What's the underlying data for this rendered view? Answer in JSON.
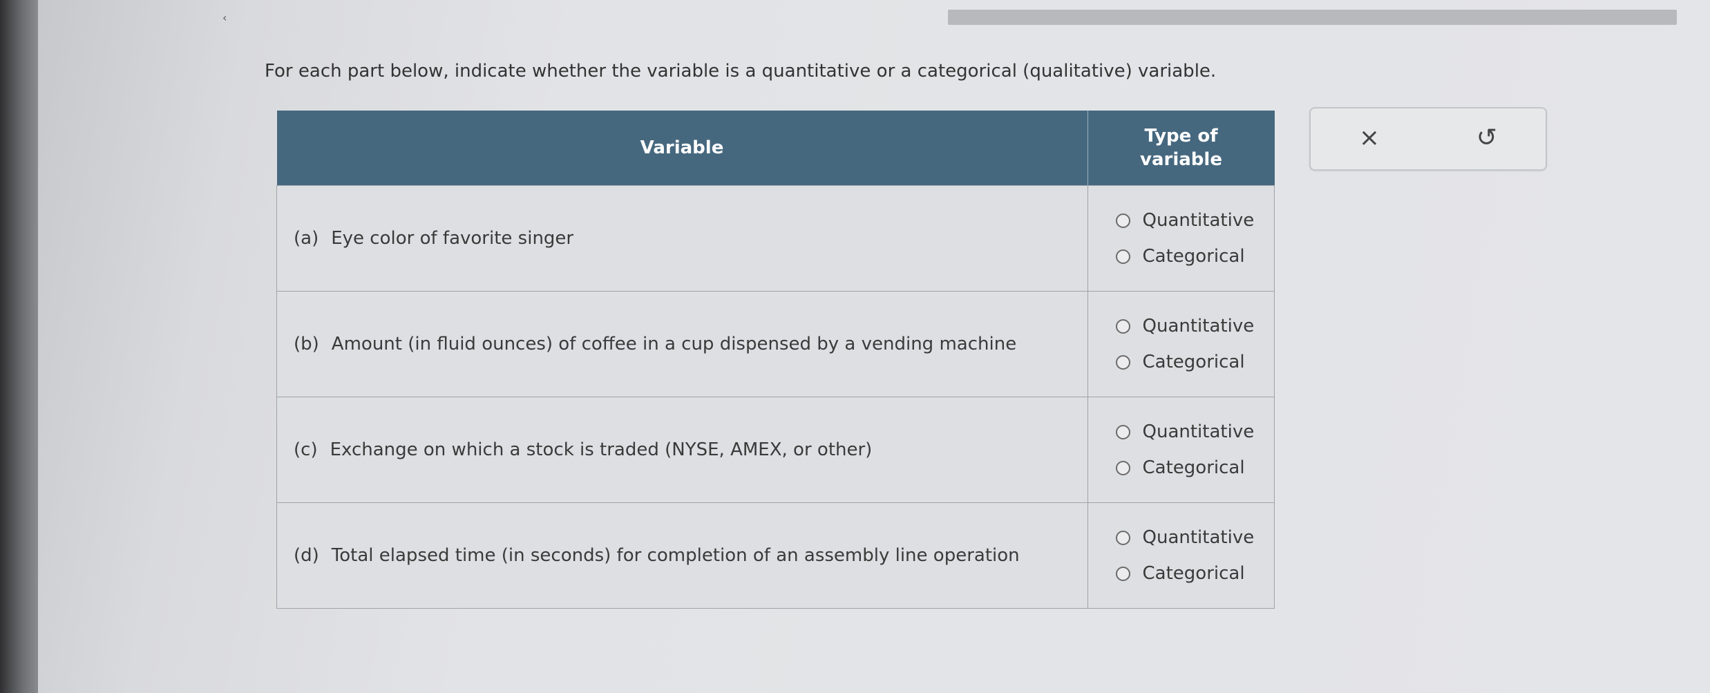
{
  "nav": {
    "back_glyph": "‹"
  },
  "instruction": "For each part below, indicate whether the variable is a quantitative or a categorical (qualitative) variable.",
  "table": {
    "header_variable": "Variable",
    "header_type_line1": "Type of",
    "header_type_line2": "variable",
    "rows": [
      {
        "letter": "(a)",
        "text": "Eye color of favorite singer",
        "option1": "Quantitative",
        "option2": "Categorical"
      },
      {
        "letter": "(b)",
        "text": "Amount (in fluid ounces) of coffee in a cup dispensed by a vending machine",
        "option1": "Quantitative",
        "option2": "Categorical"
      },
      {
        "letter": "(c)",
        "text": "Exchange on which a stock is traded (NYSE, AMEX, or other)",
        "option1": "Quantitative",
        "option2": "Categorical"
      },
      {
        "letter": "(d)",
        "text": "Total elapsed time (in seconds) for completion of an assembly line operation",
        "option1": "Quantitative",
        "option2": "Categorical"
      }
    ]
  },
  "tools": {
    "clear_glyph": "×",
    "undo_glyph": "↺"
  },
  "colors": {
    "header_bg": "#46687f",
    "cell_bg": "#dedfe2",
    "border": "#a0a2a6"
  }
}
